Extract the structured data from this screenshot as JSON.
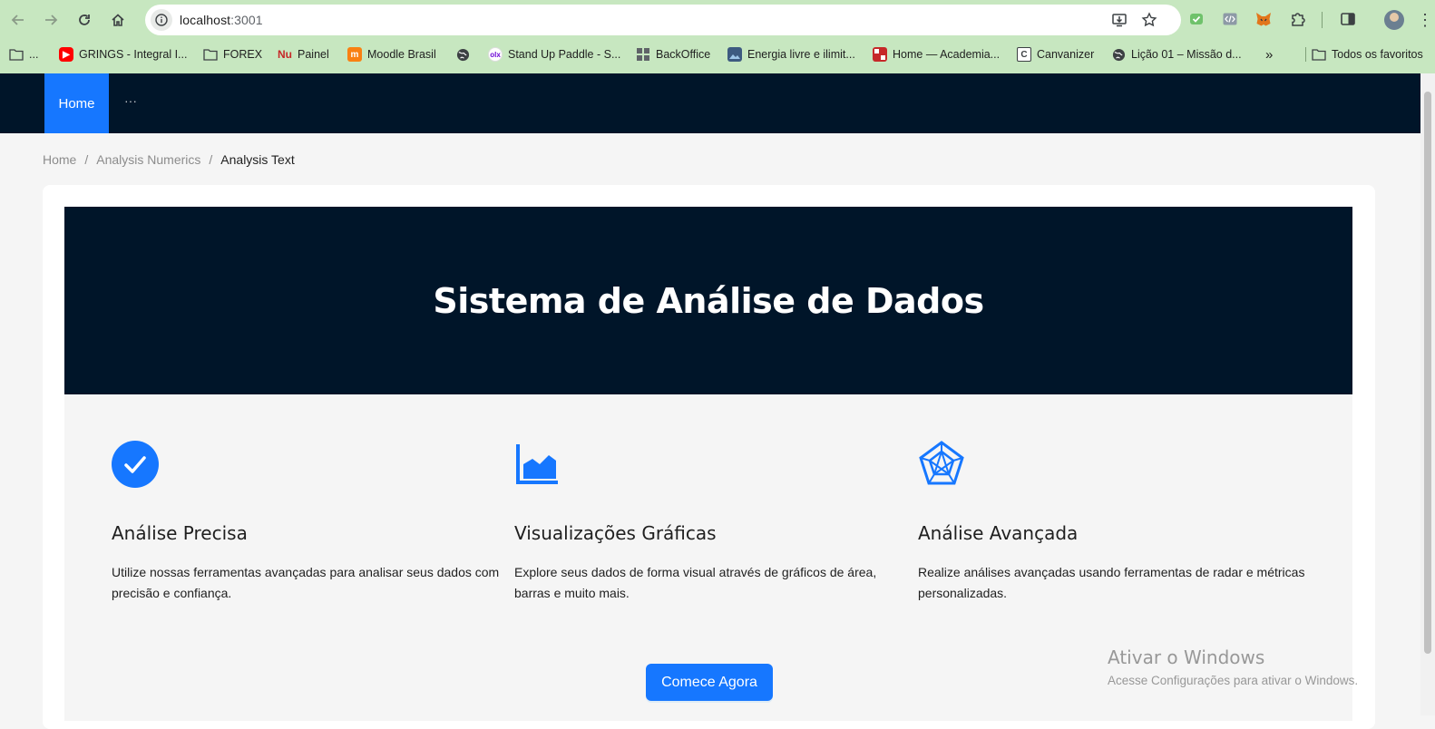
{
  "browser": {
    "url_host": "localhost",
    "url_port": ":3001",
    "bookmarks": [
      {
        "label": "...",
        "icon": "folder-icon"
      },
      {
        "label": "GRINGS - Integral I...",
        "icon": "youtube-icon",
        "color": "#ff0000"
      },
      {
        "label": "FOREX",
        "icon": "folder-icon"
      },
      {
        "label": "Painel",
        "icon": "nubank-icon",
        "color": "#820ad1"
      },
      {
        "label": "Moodle Brasil",
        "icon": "moodle-icon",
        "color": "#f98012"
      },
      {
        "label": "",
        "icon": "globe-icon"
      },
      {
        "label": "Stand Up Paddle - S...",
        "icon": "olx-icon"
      },
      {
        "label": "BackOffice",
        "icon": "grid-icon"
      },
      {
        "label": "Energia livre e ilimit...",
        "icon": "image-icon"
      },
      {
        "label": "Home — Academia...",
        "icon": "academia-icon",
        "color": "#c62828"
      },
      {
        "label": "Canvanizer",
        "icon": "canvanizer-icon"
      },
      {
        "label": "Lição 01 – Missão d...",
        "icon": "globe-icon"
      }
    ],
    "overflow": "»",
    "all_bookmarks": "Todos os favoritos"
  },
  "nav": {
    "home": "Home",
    "more": "···"
  },
  "breadcrumb": {
    "items": [
      "Home",
      "Analysis Numerics",
      "Analysis Text"
    ],
    "separator": "/"
  },
  "hero": {
    "title": "Sistema de Análise de Dados"
  },
  "features": [
    {
      "icon": "check-circle-icon",
      "title": "Análise Precisa",
      "description": "Utilize nossas ferramentas avançadas para analisar seus dados com precisão e confiança."
    },
    {
      "icon": "area-chart-icon",
      "title": "Visualizações Gráficas",
      "description": "Explore seus dados de forma visual através de gráficos de área, barras e muito mais."
    },
    {
      "icon": "radar-chart-icon",
      "title": "Análise Avançada",
      "description": "Realize análises avançadas usando ferramentas de radar e métricas personalizadas."
    }
  ],
  "cta": {
    "label": "Comece Agora"
  },
  "watermark": {
    "line1": "Ativar o Windows",
    "line2": "Acesse Configurações para ativar o Windows."
  },
  "colors": {
    "primary": "#1677ff",
    "dark": "#001529",
    "chrome": "#c7e7c0"
  }
}
